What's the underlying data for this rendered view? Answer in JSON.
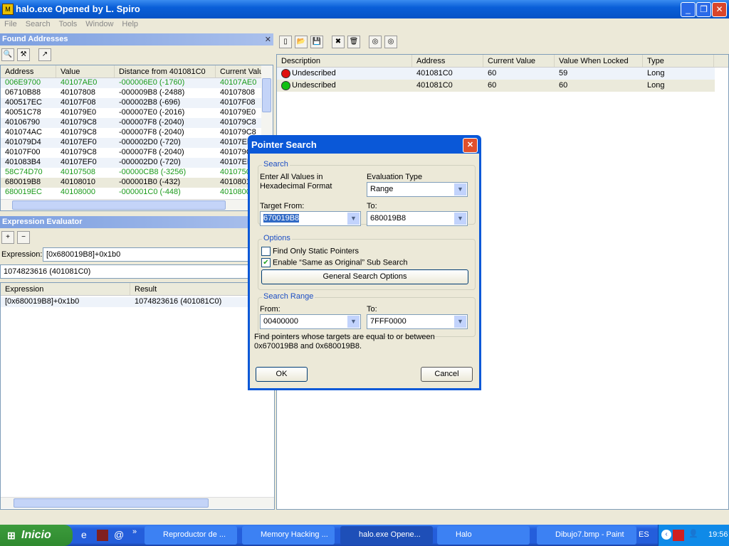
{
  "window": {
    "title": "halo.exe Opened by L. Spiro"
  },
  "menu": [
    "File",
    "Search",
    "Tools",
    "Window",
    "Help"
  ],
  "found": {
    "title": "Found Addresses",
    "columns": [
      "Address",
      "Value",
      "Distance from 401081C0",
      "Current Valu"
    ],
    "rows": [
      {
        "a": "006E9700",
        "v": "40107AE0",
        "d": "-000006E0 (-1760)",
        "c": "40107AE0",
        "green": true
      },
      {
        "a": "06710B88",
        "v": "40107808",
        "d": "-000009B8 (-2488)",
        "c": "40107808"
      },
      {
        "a": "400517EC",
        "v": "40107F08",
        "d": "-000002B8 (-696)",
        "c": "40107F08"
      },
      {
        "a": "40051C78",
        "v": "401079E0",
        "d": "-000007E0 (-2016)",
        "c": "401079E0"
      },
      {
        "a": "40106790",
        "v": "401079C8",
        "d": "-000007F8 (-2040)",
        "c": "401079C8"
      },
      {
        "a": "401074AC",
        "v": "401079C8",
        "d": "-000007F8 (-2040)",
        "c": "401079C8"
      },
      {
        "a": "401079D4",
        "v": "40107EF0",
        "d": "-000002D0 (-720)",
        "c": "40107EF0"
      },
      {
        "a": "40107F00",
        "v": "401079C8",
        "d": "-000007F8 (-2040)",
        "c": "401079C8"
      },
      {
        "a": "401083B4",
        "v": "40107EF0",
        "d": "-000002D0 (-720)",
        "c": "40107EF0"
      },
      {
        "a": "58C74D70",
        "v": "40107508",
        "d": "-00000CB8 (-3256)",
        "c": "40107508",
        "green": true
      },
      {
        "a": "680019B8",
        "v": "40108010",
        "d": "-000001B0 (-432)",
        "c": "40108010",
        "sel": true
      },
      {
        "a": "680019EC",
        "v": "40108000",
        "d": "-000001C0 (-448)",
        "c": "40108000",
        "green": true
      }
    ]
  },
  "evaluator": {
    "title": "Expression Evaluator",
    "expr_label": "Expression:",
    "expr_value": "[0x680019B8]+0x1b0",
    "result": "1074823616 (401081C0)",
    "columns": [
      "Expression",
      "Result"
    ],
    "rows": [
      {
        "e": "[0x680019B8]+0x1b0",
        "r": "1074823616 (401081C0)"
      }
    ]
  },
  "locked": {
    "columns": [
      "Description",
      "Address",
      "Current Value",
      "Value When Locked",
      "Type"
    ],
    "rows": [
      {
        "desc": "Undescribed",
        "addr": "401081C0",
        "cur": "60",
        "lock": "59",
        "type": "Long",
        "status": "red"
      },
      {
        "desc": "Undescribed",
        "addr": "401081C0",
        "cur": "60",
        "lock": "60",
        "type": "Long",
        "status": "green"
      }
    ]
  },
  "dialog": {
    "title": "Pointer Search",
    "search_group": "Search",
    "hint": "Enter All Values in Hexadecimal Format",
    "eval_label": "Evaluation Type",
    "eval_value": "Range",
    "target_from_label": "Target From:",
    "target_from": "670019B8",
    "to_label": "To:",
    "target_to": "680019B8",
    "options_group": "Options",
    "static_only": "Find Only Static Pointers",
    "static_checked": false,
    "same_as_orig": "Enable “Same as Original” Sub Search",
    "same_checked": true,
    "general_btn": "General Search Options",
    "range_group": "Search Range",
    "from_label": "From:",
    "range_from": "00400000",
    "range_to_label": "To:",
    "range_to": "7FFF0000",
    "description": "Find pointers whose targets are equal to or between 0x670019B8 and 0x680019B8.",
    "ok": "OK",
    "cancel": "Cancel"
  },
  "taskbar": {
    "start": "Inicio",
    "tasks": [
      "Reproductor de ...",
      "Memory Hacking ...",
      "halo.exe Opene...",
      "Halo",
      "Dibujo7.bmp - Paint"
    ],
    "active": 2,
    "lang": "ES",
    "clock": "19:56"
  }
}
